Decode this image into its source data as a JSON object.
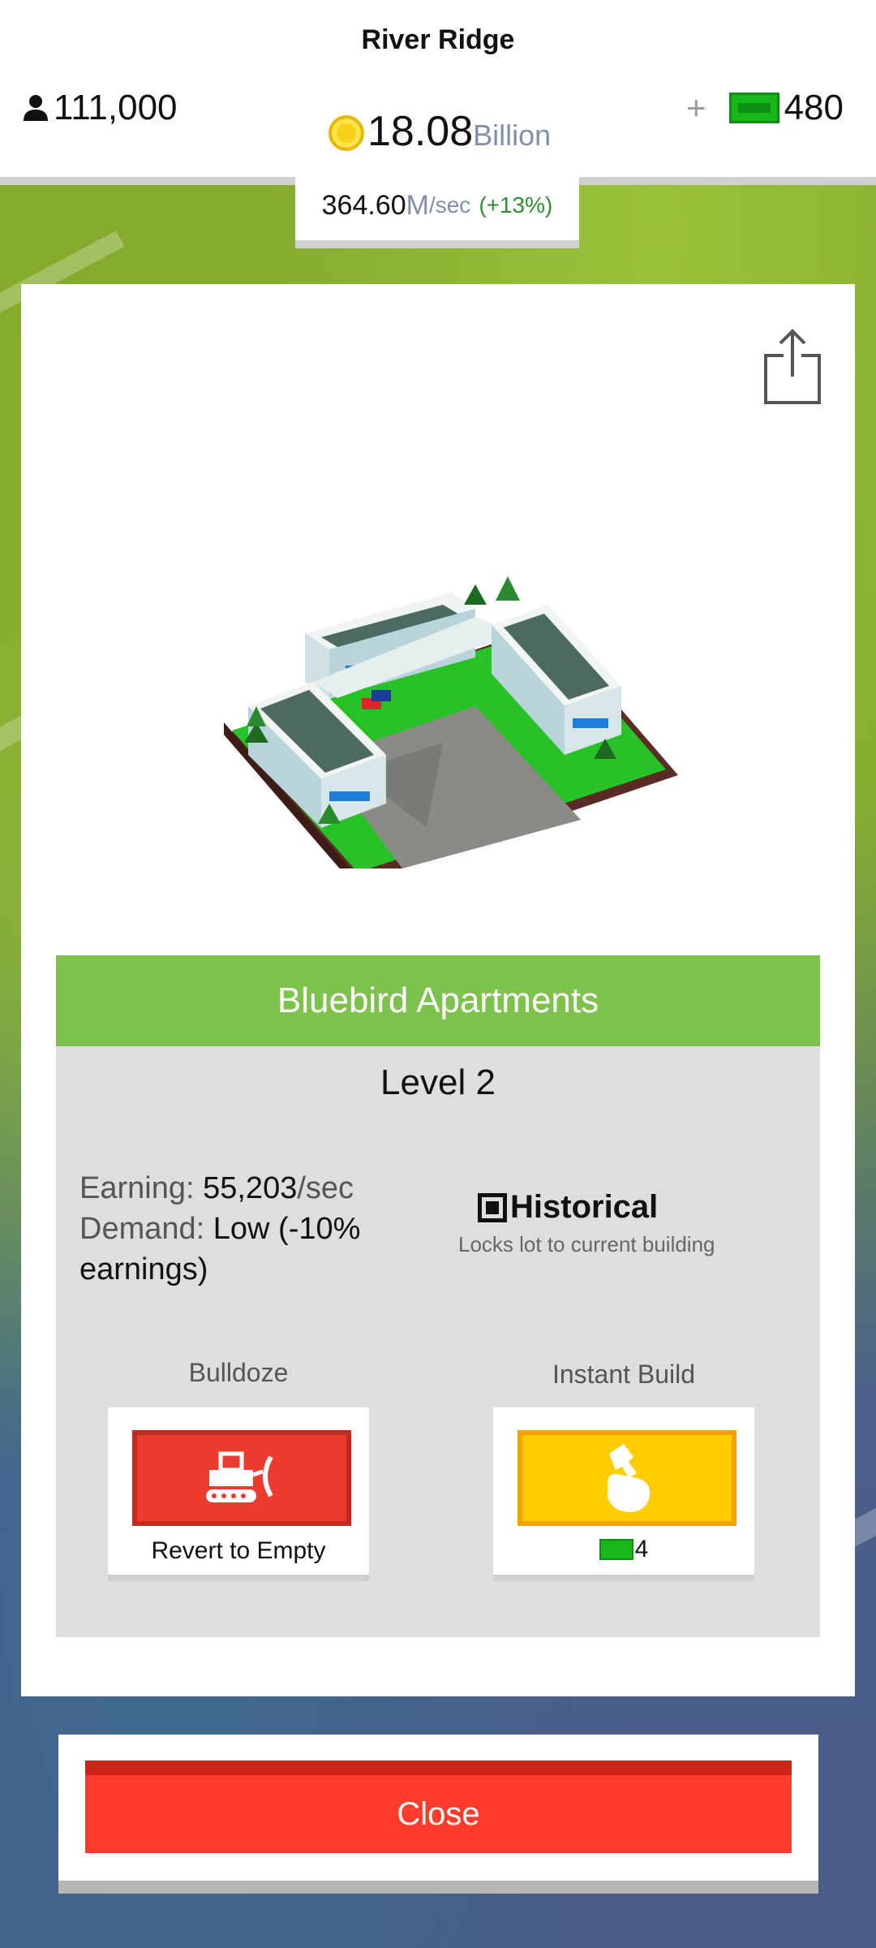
{
  "city": {
    "name": "River Ridge"
  },
  "header": {
    "population": "111,000",
    "coins_value": "18.08",
    "coins_unit": "Billion",
    "plus": "+",
    "cash": "480"
  },
  "income": {
    "rate": "364.60",
    "unit_m": "M",
    "unit_sec": "/sec",
    "change": "(+13%)"
  },
  "building": {
    "name": "Bluebird Apartments",
    "level": "Level 2",
    "earning_label": "Earning:",
    "earning_value": "55,203",
    "earning_unit": "/sec",
    "demand_label": "Demand:",
    "demand_value_line1": "Low (-10%",
    "demand_value_line2": "earnings)",
    "historical_label": "Historical",
    "historical_checked": true,
    "historical_desc": "Locks lot to current building"
  },
  "actions": {
    "bulldoze_label": "Bulldoze",
    "bulldoze_caption": "Revert to Empty",
    "instant_label": "Instant Build",
    "instant_cost": "4"
  },
  "close_label": "Close",
  "colors": {
    "title_bar": "#7dc24b",
    "bulldoze": "#ed3b2f",
    "instant": "#ffcc00",
    "close": "#ff3b2c",
    "cash_green": "#19b81a"
  }
}
